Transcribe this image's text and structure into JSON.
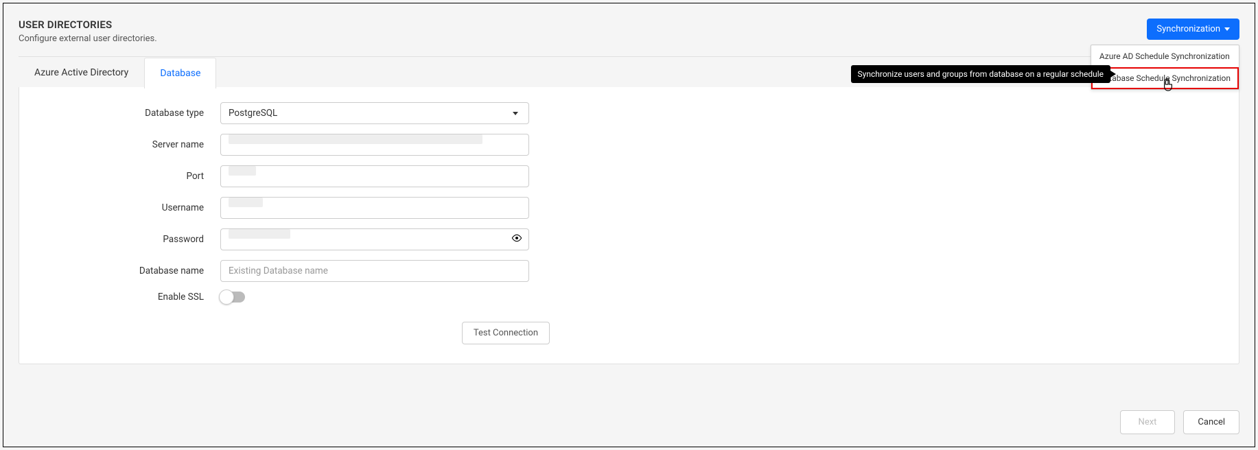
{
  "header": {
    "title": "USER DIRECTORIES",
    "subtitle": "Configure external user directories."
  },
  "sync_button": {
    "label": "Synchronization"
  },
  "dropdown": {
    "item1": "Azure AD Schedule Synchronization",
    "item2": "Database Schedule Synchronization"
  },
  "tooltip": {
    "text": "Synchronize users and groups from database on a regular schedule"
  },
  "tabs": {
    "tab1": "Azure Active Directory",
    "tab2": "Database"
  },
  "form": {
    "db_type_label": "Database type",
    "db_type_value": "PostgreSQL",
    "server_label": "Server name",
    "port_label": "Port",
    "username_label": "Username",
    "password_label": "Password",
    "dbname_label": "Database name",
    "dbname_placeholder": "Existing Database name",
    "ssl_label": "Enable SSL",
    "test_button": "Test Connection"
  },
  "footer": {
    "next": "Next",
    "cancel": "Cancel"
  }
}
